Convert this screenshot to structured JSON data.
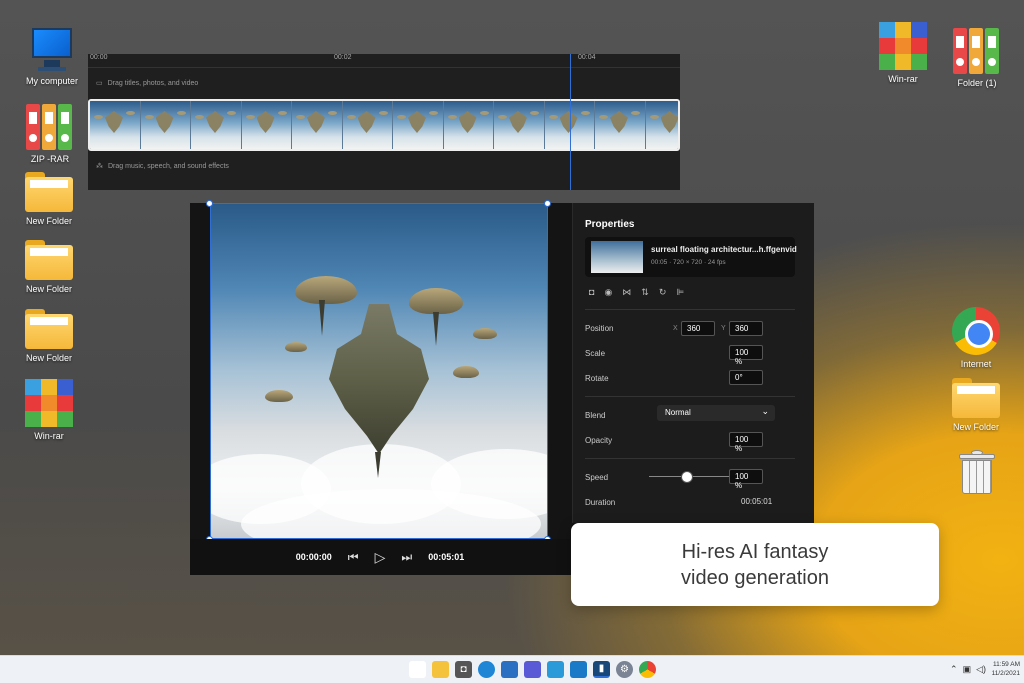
{
  "desktop": {
    "left_icons": [
      {
        "label": "My computer",
        "icon": "computer-icon"
      },
      {
        "label": "ZIP -RAR",
        "icon": "binders-icon"
      },
      {
        "label": "New Folder",
        "icon": "folder-icon"
      },
      {
        "label": "New Folder",
        "icon": "folder-icon"
      },
      {
        "label": "New Folder",
        "icon": "folder-icon"
      },
      {
        "label": "Win-rar",
        "icon": "winrar-icon"
      }
    ],
    "right_icons": [
      {
        "label": "Win-rar",
        "icon": "winrar-icon"
      },
      {
        "label": "Folder (1)",
        "icon": "binders-icon"
      },
      {
        "label": "Internet",
        "icon": "chrome-icon"
      },
      {
        "label": "New Folder",
        "icon": "folder-icon"
      },
      {
        "label": "",
        "icon": "trash-icon"
      }
    ]
  },
  "timeline": {
    "ticks": [
      "00:00",
      "00:02",
      "00:04"
    ],
    "text_track_hint": "Drag titles, photos, and video",
    "audio_track_hint": "Drag music, speech, and sound effects"
  },
  "player": {
    "current_time": "00:00:00",
    "total_time": "00:05:01"
  },
  "properties": {
    "title": "Properties",
    "clip_name": "surreal floating architectur...h.ffgenvid",
    "clip_meta": "00:05 · 720 × 720 · 24 fps",
    "position_label": "Position",
    "x_label": "X",
    "x_value": "360",
    "y_label": "Y",
    "y_value": "360",
    "scale_label": "Scale",
    "scale_value": "100 %",
    "rotate_label": "Rotate",
    "rotate_value": "0°",
    "blend_label": "Blend",
    "blend_value": "Normal",
    "opacity_label": "Opacity",
    "opacity_value": "100 %",
    "speed_label": "Speed",
    "speed_value": "100 %",
    "duration_label": "Duration",
    "duration_value": "00:05:01"
  },
  "caption": {
    "line1": "Hi-res AI fantasy",
    "line2": "video generation"
  },
  "taskbar": {
    "time": "11:59 AM",
    "date": "11/2/2021"
  },
  "colors": {
    "accent": "#2f6fd6",
    "wallpaper_glow": "#f2b212"
  }
}
